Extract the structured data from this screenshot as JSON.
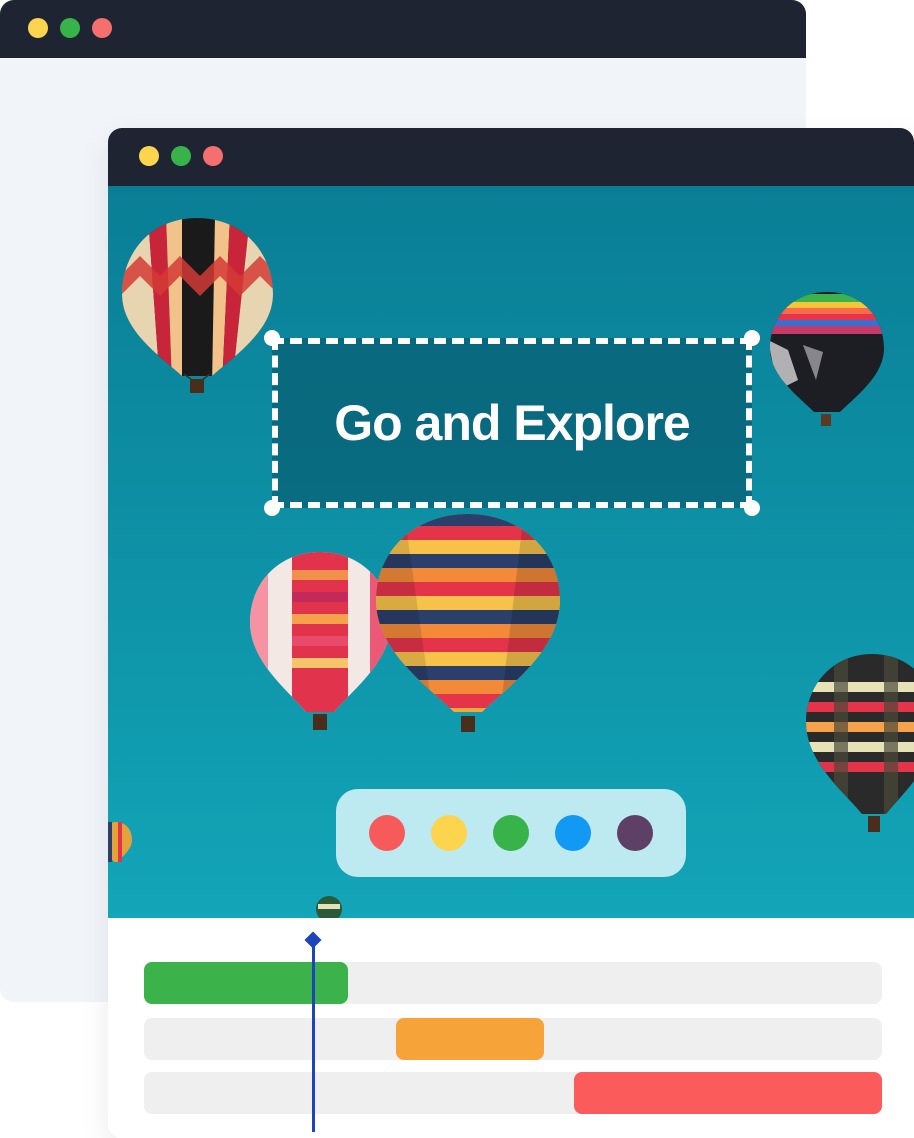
{
  "back_window": {
    "traffic_lights": [
      "#fdd44e",
      "#38b34a",
      "#f56f6f"
    ]
  },
  "front_window": {
    "traffic_lights": [
      "#fdd44e",
      "#38b34a",
      "#f56f6f"
    ]
  },
  "canvas": {
    "selected_text": "Go and Explore"
  },
  "palette": {
    "colors": [
      {
        "name": "red",
        "hex": "#f75a5a"
      },
      {
        "name": "yellow",
        "hex": "#fdd44e"
      },
      {
        "name": "green",
        "hex": "#38b34a"
      },
      {
        "name": "blue",
        "hex": "#1199f4"
      },
      {
        "name": "purple",
        "hex": "#5e3f65"
      }
    ]
  },
  "timeline": {
    "tracks": [
      {
        "name": "track-1",
        "clip_color": "#3bb24a"
      },
      {
        "name": "track-2",
        "clip_color": "#f6a33a"
      },
      {
        "name": "track-3",
        "clip_color": "#fb5b5b"
      }
    ],
    "playhead_color": "#1d44b8"
  }
}
